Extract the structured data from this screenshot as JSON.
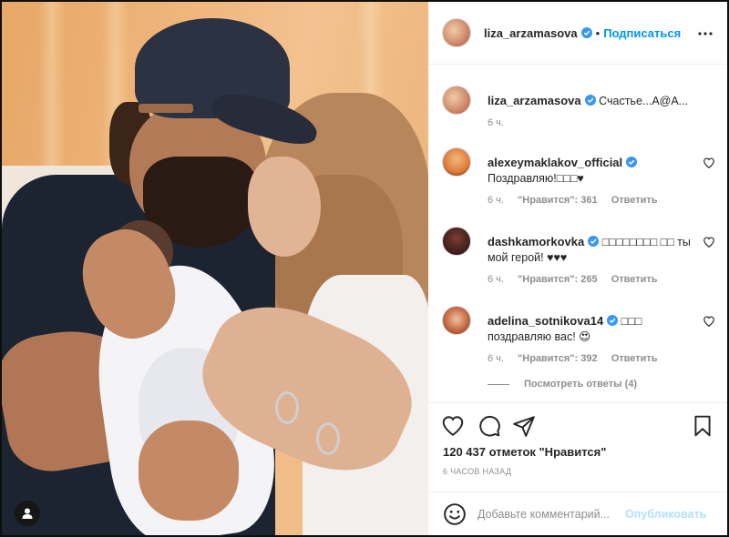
{
  "post": {
    "author": "liza_arzamasova",
    "follow_label": "Подписаться",
    "separator": "•",
    "caption": "Счастье...A@A...",
    "caption_time": "6 ч.",
    "likes_text": "120 437 отметок \"Нравится\"",
    "time_ago": "6 ЧАСОВ НАЗАД"
  },
  "comments": [
    {
      "user": "alexeymaklakov_official",
      "text": "Поздравляю!□□□♥",
      "time": "6 ч.",
      "likes": "\"Нравится\": 361",
      "reply": "Ответить"
    },
    {
      "user": "dashkamorkovka",
      "text": "□□□□□□□□ □□ ты мой герой! ♥♥♥",
      "time": "6 ч.",
      "likes": "\"Нравится\": 265",
      "reply": "Ответить"
    },
    {
      "user": "adelina_sotnikova14",
      "text": "□□□ поздравляю вас! 😍",
      "time": "6 ч.",
      "likes": "\"Нравится\": 392",
      "reply": "Ответить"
    }
  ],
  "view_replies": "Посмотреть ответы (4)",
  "comment_box": {
    "placeholder": "Добавьте комментарий...",
    "publish_label": "Опубликовать"
  },
  "colors": {
    "accent": "#0095f6",
    "publish_disabled": "#b2dffc",
    "muted": "#8e8e8e",
    "text": "#262626"
  },
  "icons": {
    "verified": "verified-badge-icon",
    "more": "more-options-icon",
    "like": "heart-icon",
    "comment": "comment-icon",
    "share": "paper-plane-icon",
    "save": "bookmark-icon",
    "emoji": "emoji-icon",
    "tagged_user": "user-tag-icon"
  }
}
